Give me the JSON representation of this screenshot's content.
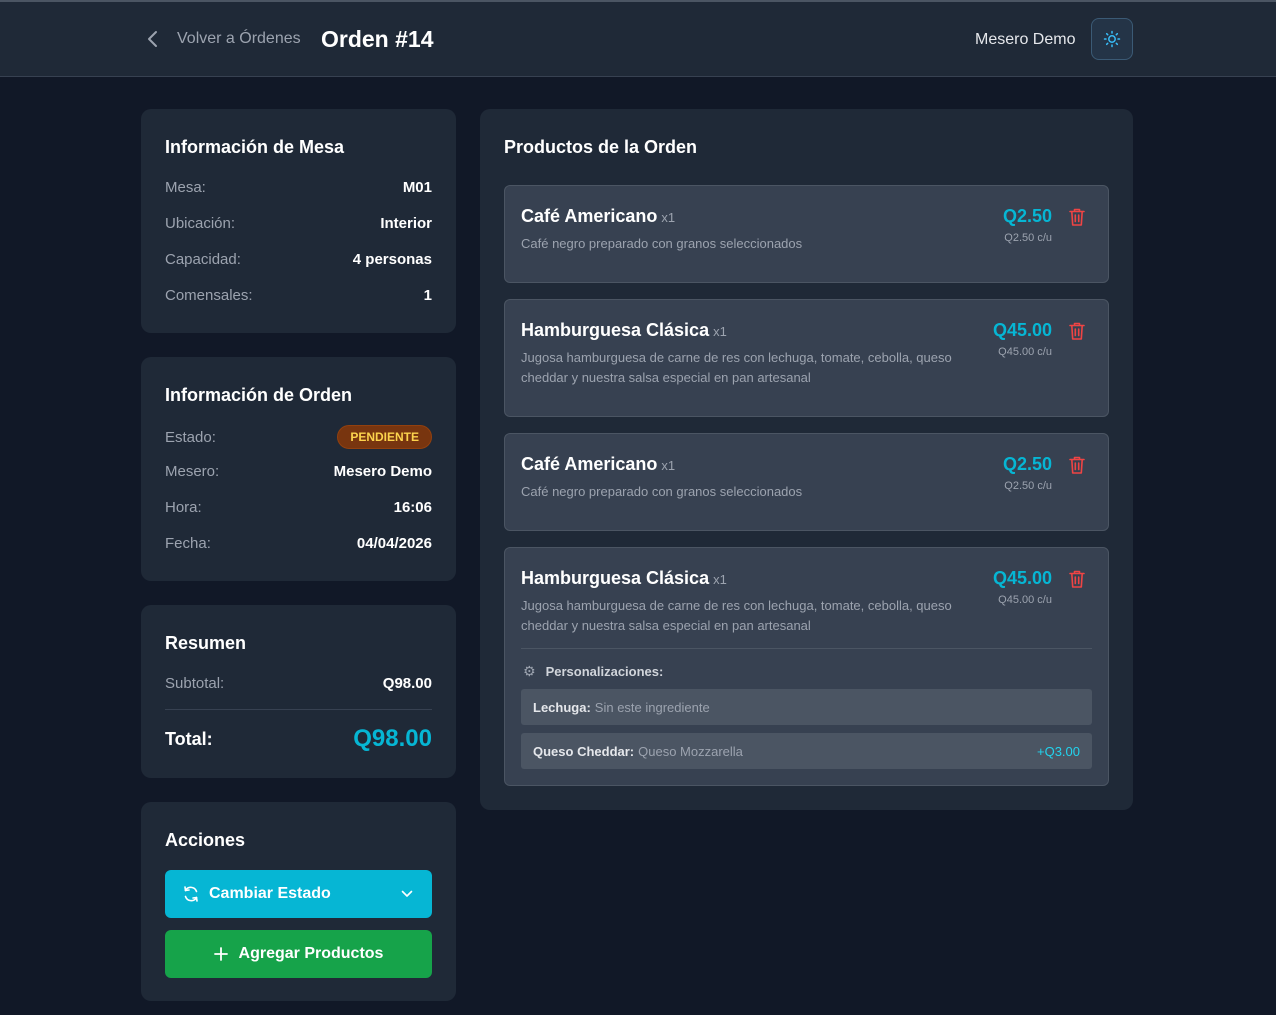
{
  "header": {
    "back_label": "Volver a Órdenes",
    "order_title": "Orden #14",
    "user_name": "Mesero Demo"
  },
  "mesa": {
    "title": "Información de Mesa",
    "rows": [
      {
        "label": "Mesa:",
        "value": "M01"
      },
      {
        "label": "Ubicación:",
        "value": "Interior"
      },
      {
        "label": "Capacidad:",
        "value": "4 personas"
      },
      {
        "label": "Comensales:",
        "value": "1"
      }
    ]
  },
  "orden": {
    "title": "Información de Orden",
    "estado_label": "Estado:",
    "estado_value": "PENDIENTE",
    "rows": [
      {
        "label": "Mesero:",
        "value": "Mesero Demo"
      },
      {
        "label": "Hora:",
        "value": "16:06"
      },
      {
        "label": "Fecha:",
        "value": "04/04/2026"
      }
    ]
  },
  "resumen": {
    "title": "Resumen",
    "subtotal_label": "Subtotal:",
    "subtotal_value": "Q98.00",
    "total_label": "Total:",
    "total_value": "Q98.00"
  },
  "acciones": {
    "title": "Acciones",
    "cambiar_estado": "Cambiar Estado",
    "agregar_productos": "Agregar Productos"
  },
  "productos": {
    "title": "Productos de la Orden",
    "items": [
      {
        "name": "Café Americano",
        "qty": "x1",
        "description": "Café negro preparado con granos seleccionados",
        "price": "Q2.50",
        "unit_price": "Q2.50 c/u"
      },
      {
        "name": "Hamburguesa Clásica",
        "qty": "x1",
        "description": "Jugosa hamburguesa de carne de res con lechuga, tomate, cebolla, queso cheddar y nuestra salsa especial en pan artesanal",
        "price": "Q45.00",
        "unit_price": "Q45.00 c/u"
      },
      {
        "name": "Café Americano",
        "qty": "x1",
        "description": "Café negro preparado con granos seleccionados",
        "price": "Q2.50",
        "unit_price": "Q2.50 c/u"
      },
      {
        "name": "Hamburguesa Clásica",
        "qty": "x1",
        "description": "Jugosa hamburguesa de carne de res con lechuga, tomate, cebolla, queso cheddar y nuestra salsa especial en pan artesanal",
        "price": "Q45.00",
        "unit_price": "Q45.00 c/u",
        "customizations_label": "Personalizaciones:",
        "customizations": [
          {
            "name": "Lechuga:",
            "value": "Sin este ingrediente",
            "extra": ""
          },
          {
            "name": "Queso Cheddar:",
            "value": "Queso Mozzarella",
            "extra": "+Q3.00"
          }
        ]
      }
    ]
  },
  "colors": {
    "background": "#111827",
    "card": "#1f2937",
    "accent": "#06b6d4",
    "success": "#16a34a",
    "danger": "#ef4444",
    "badge_pending": "#78350f"
  },
  "icons": {
    "back": "chevron-left-icon",
    "theme": "sun-icon",
    "refresh": "refresh-icon",
    "dropdown": "chevron-down-icon",
    "add": "plus-icon",
    "delete": "trash-icon",
    "customizations": "gear-icon"
  }
}
